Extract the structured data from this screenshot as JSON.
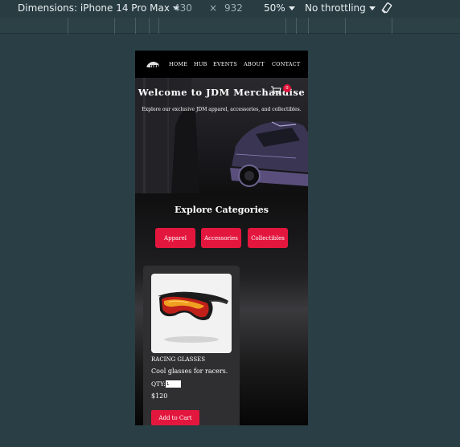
{
  "devtools": {
    "dimensions_label": "Dimensions: iPhone 14 Pro Max",
    "width": "430",
    "times": "×",
    "height": "932",
    "zoom": "50%",
    "throttling": "No throttling"
  },
  "nav": {
    "items": [
      "HOME",
      "HUB",
      "EVENTS",
      "ABOUT",
      "CONTACT"
    ],
    "cart_count": "0"
  },
  "hero": {
    "title": "Welcome to JDM Merchandise",
    "subtitle": "Explore our exclusive JDM apparel, accessories, and collectibles."
  },
  "categories": {
    "title": "Explore Categories",
    "buttons": [
      "Apparel",
      "Accessories",
      "Collectibles"
    ]
  },
  "product": {
    "name": "RACING GLASSES",
    "description": "Cool glasses for racers.",
    "qty_label": "QTY:",
    "qty_value": "1",
    "price": "$120",
    "add_label": "Add to Cart"
  },
  "colors": {
    "accent": "#e3173e",
    "devtools_bg": "#2a3f45"
  }
}
